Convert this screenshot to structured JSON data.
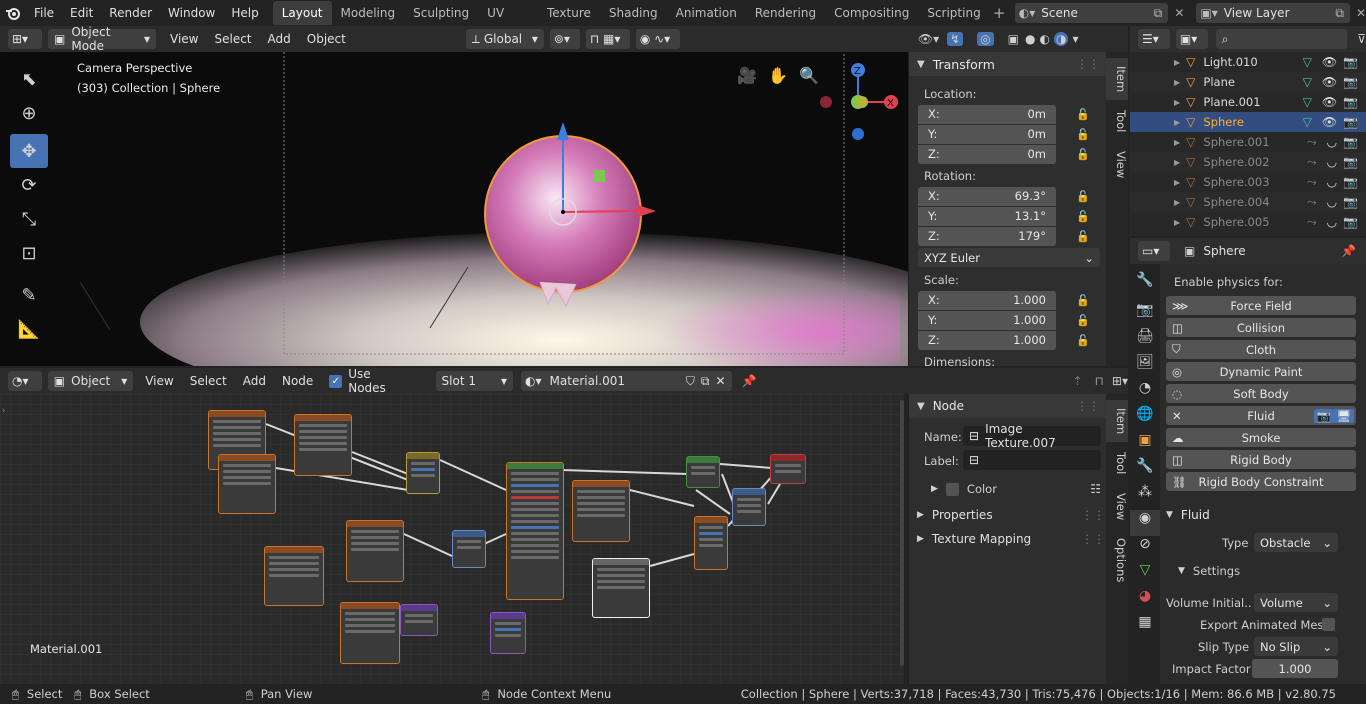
{
  "menu": [
    "File",
    "Edit",
    "Render",
    "Window",
    "Help"
  ],
  "workspaces": [
    "Layout",
    "Modeling",
    "Sculpting",
    "UV Editing",
    "Texture Paint",
    "Shading",
    "Animation",
    "Rendering",
    "Compositing",
    "Scripting"
  ],
  "active_workspace": "Layout",
  "scene_name": "Scene",
  "view_layer": "View Layer",
  "viewport": {
    "mode": "Object Mode",
    "menus": [
      "View",
      "Select",
      "Add",
      "Object"
    ],
    "orientation": "Global",
    "overlay_title": "Camera Perspective",
    "overlay_sub": "(303) Collection | Sphere",
    "gizmo": {
      "z": "Z",
      "x": "X"
    }
  },
  "transform_panel": {
    "title": "Transform",
    "location_label": "Location:",
    "location": [
      {
        "k": "X:",
        "v": "0m"
      },
      {
        "k": "Y:",
        "v": "0m"
      },
      {
        "k": "Z:",
        "v": "0m"
      }
    ],
    "rotation_label": "Rotation:",
    "rotation": [
      {
        "k": "X:",
        "v": "69.3°"
      },
      {
        "k": "Y:",
        "v": "13.1°"
      },
      {
        "k": "Z:",
        "v": "179°"
      }
    ],
    "rotation_mode": "XYZ Euler",
    "scale_label": "Scale:",
    "scale": [
      {
        "k": "X:",
        "v": "1.000"
      },
      {
        "k": "Y:",
        "v": "1.000"
      },
      {
        "k": "Z:",
        "v": "1.000"
      }
    ],
    "dimensions_label": "Dimensions:"
  },
  "side_tabs_top": [
    "Item",
    "Tool",
    "View"
  ],
  "outliner": {
    "search_placeholder": "",
    "items": [
      {
        "name": "Light.010",
        "active": false,
        "dim": false
      },
      {
        "name": "Plane",
        "active": false,
        "dim": false
      },
      {
        "name": "Plane.001",
        "active": false,
        "dim": false
      },
      {
        "name": "Sphere",
        "active": true,
        "dim": false
      },
      {
        "name": "Sphere.001",
        "active": false,
        "dim": true
      },
      {
        "name": "Sphere.002",
        "active": false,
        "dim": true
      },
      {
        "name": "Sphere.003",
        "active": false,
        "dim": true
      },
      {
        "name": "Sphere.004",
        "active": false,
        "dim": true
      },
      {
        "name": "Sphere.005",
        "active": false,
        "dim": true
      }
    ]
  },
  "properties": {
    "object_name": "Sphere",
    "enable_physics_label": "Enable physics for:",
    "physics_buttons": [
      "Force Field",
      "Collision",
      "Cloth",
      "Dynamic Paint",
      "Soft Body",
      "Fluid",
      "Smoke",
      "Rigid Body",
      "Rigid Body Constraint"
    ],
    "fluid_section": "Fluid",
    "type_label": "Type",
    "type_value": "Obstacle",
    "settings_label": "Settings",
    "volume_label": "Volume Initial..",
    "volume_value": "Volume",
    "export_label": "Export Animated Mesh",
    "slip_label": "Slip Type",
    "slip_value": "No Slip",
    "impact_label": "Impact Factor",
    "impact_value": "1.000"
  },
  "node_editor": {
    "editor_type": "Object",
    "menus": [
      "View",
      "Select",
      "Add",
      "Node"
    ],
    "use_nodes_label": "Use Nodes",
    "slot": "Slot 1",
    "material": "Material.001",
    "canvas_label": "Material.001"
  },
  "node_panel": {
    "title": "Node",
    "name_label": "Name:",
    "name_value": "Image Texture.007",
    "label_label": "Label:",
    "label_value": "",
    "color_label": "Color",
    "properties_label": "Properties",
    "texture_mapping_label": "Texture Mapping"
  },
  "side_tabs_bottom": [
    "Item",
    "Tool",
    "View",
    "Options"
  ],
  "statusbar": {
    "select": "Select",
    "box_select": "Box Select",
    "pan_view": "Pan View",
    "node_context": "Node Context Menu",
    "stats": "Collection | Sphere | Verts:37,718 | Faces:43,730 | Tris:75,476 | Objects:1/16 | Mem: 86.6 MB | v2.80.75"
  },
  "colors": {
    "accent": "#4772b3",
    "active_text": "#ffaf29",
    "node_border": "#c7752a"
  }
}
